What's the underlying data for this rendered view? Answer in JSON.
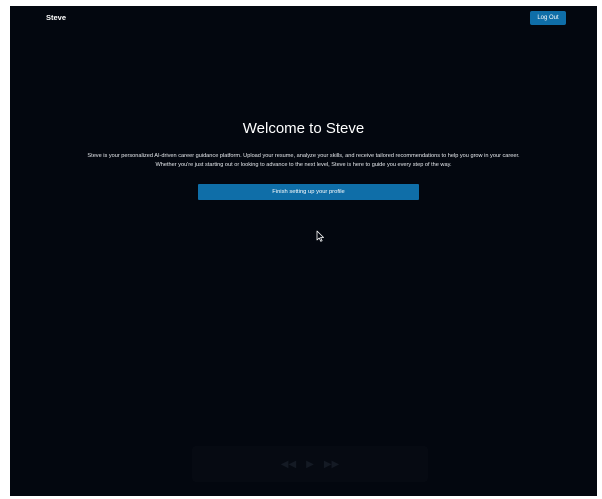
{
  "header": {
    "brand": "Steve",
    "logout_label": "Log Out"
  },
  "hero": {
    "title": "Welcome to Steve",
    "description_line1": "Steve is your personalized AI-driven career guidance platform. Upload your resume, analyze your skills, and receive tailored recommendations to help you grow in your career.",
    "description_line2": "Whether you're just starting out or looking to advance to the next level, Steve is here to guide you every step of the way.",
    "cta_label": "Finish setting up your profile"
  },
  "colors": {
    "background": "#03070f",
    "accent": "#0f6ea8",
    "text": "#ffffff"
  },
  "icons": {
    "cursor": "mouse-pointer-icon",
    "player_controls": [
      "rewind-icon",
      "play-icon",
      "fast-forward-icon"
    ]
  }
}
